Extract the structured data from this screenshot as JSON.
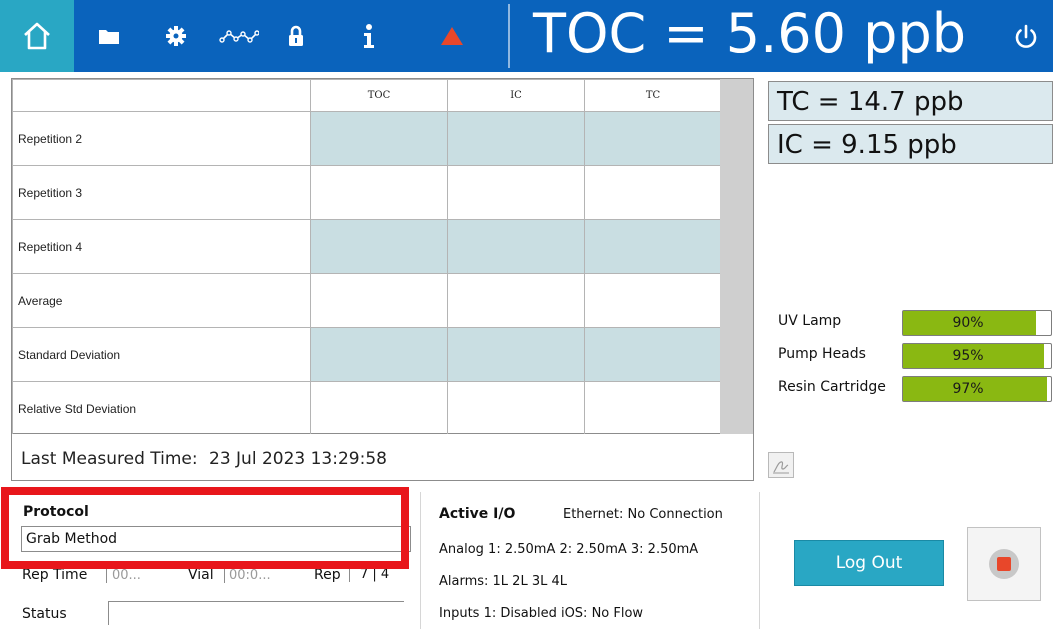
{
  "topbar": {
    "icons": [
      "home-icon",
      "folder-icon",
      "gear-icon",
      "trend-icon",
      "lock-icon",
      "info-icon",
      "alarm-triangle-icon",
      "power-icon"
    ],
    "toc_reading": "TOC = 5.60 ppb"
  },
  "colors": {
    "topbar": "#0a63bc",
    "accent": "#29a7c4",
    "alarm": "#e8472a",
    "bar_fill": "#8ab812",
    "row_shade": "#c9dee2",
    "highlight": "#e8161b"
  },
  "results_table": {
    "columns": [
      "TOC",
      "IC",
      "TC"
    ],
    "rows": [
      {
        "label": "Repetition 2",
        "values": [
          "",
          "",
          ""
        ]
      },
      {
        "label": "Repetition 3",
        "values": [
          "",
          "",
          ""
        ]
      },
      {
        "label": "Repetition 4",
        "values": [
          "",
          "",
          ""
        ]
      },
      {
        "label": "Average",
        "values": [
          "",
          "",
          ""
        ]
      },
      {
        "label": "Standard Deviation",
        "values": [
          "",
          "",
          ""
        ]
      },
      {
        "label": "Relative Std Deviation",
        "values": [
          "",
          "",
          ""
        ]
      }
    ],
    "last_measured_label": "Last Measured Time:",
    "last_measured_value": "23 Jul 2023 13:29:58"
  },
  "readouts": {
    "tc": "TC = 14.7 ppb",
    "ic": "IC = 9.15 ppb"
  },
  "consumables": [
    {
      "label": "UV Lamp",
      "percent_text": "90%",
      "fraction": 0.9
    },
    {
      "label": "Pump Heads",
      "percent_text": "95%",
      "fraction": 0.95
    },
    {
      "label": "Resin Cartridge",
      "percent_text": "97%",
      "fraction": 0.97
    }
  ],
  "protocol": {
    "title": "Protocol",
    "value": "Grab Method",
    "rep_time_label": "Rep Time",
    "rep_time_value": "00...",
    "vial_label": "Vial",
    "vial_value": "00:0...",
    "rep_label": "Rep",
    "rep_value": "7 | 4",
    "status_label": "Status",
    "status_value": ""
  },
  "active_io": {
    "title": "Active I/O",
    "ethernet": "Ethernet: No Connection",
    "analog": "Analog 1: 2.50mA  2: 2.50mA  3: 2.50mA",
    "alarms": "Alarms: 1L 2L 3L 4L",
    "inputs": "Inputs 1: Disabled  iOS: No Flow"
  },
  "buttons": {
    "logout_label": "Log Out"
  }
}
